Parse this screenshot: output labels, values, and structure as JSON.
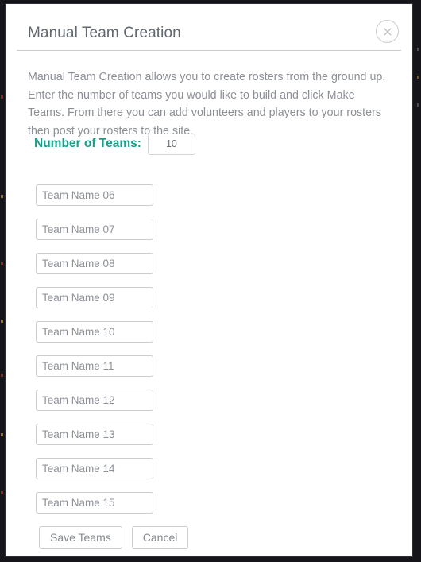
{
  "modal": {
    "title": "Manual Team Creation",
    "close_icon": "close-x-circle-icon",
    "intro_text": "Manual Team Creation allows you to create rosters from the ground up. Enter the number of teams you would like to build and click Make Teams. From there you can add volunteers and players to your rosters then post your rosters to the site.",
    "teams_count": {
      "label": "Number of Teams:",
      "value": "10",
      "placeholder": ""
    },
    "team_inputs": [
      {
        "value": "Team Name 06",
        "placeholder": "Team Name 06"
      },
      {
        "value": "Team Name 07",
        "placeholder": "Team Name 07"
      },
      {
        "value": "Team Name 08",
        "placeholder": "Team Name 08"
      },
      {
        "value": "Team Name 09",
        "placeholder": "Team Name 09"
      },
      {
        "value": "Team Name 10",
        "placeholder": "Team Name 10"
      },
      {
        "value": "Team Name 11",
        "placeholder": "Team Name 11"
      },
      {
        "value": "Team Name 12",
        "placeholder": "Team Name 12"
      },
      {
        "value": "Team Name 13",
        "placeholder": "Team Name 13"
      },
      {
        "value": "Team Name 14",
        "placeholder": "Team Name 14"
      },
      {
        "value": "Team Name 15",
        "placeholder": "Team Name 15"
      }
    ],
    "actions": {
      "save_label": "Save Teams",
      "cancel_label": "Cancel"
    }
  },
  "colors": {
    "accent_teal": "#17a08a",
    "title_gray": "#5f666f",
    "body_gray": "#8c9096",
    "border_gray": "#c9cdd2",
    "backdrop_dark": "#16161a"
  }
}
